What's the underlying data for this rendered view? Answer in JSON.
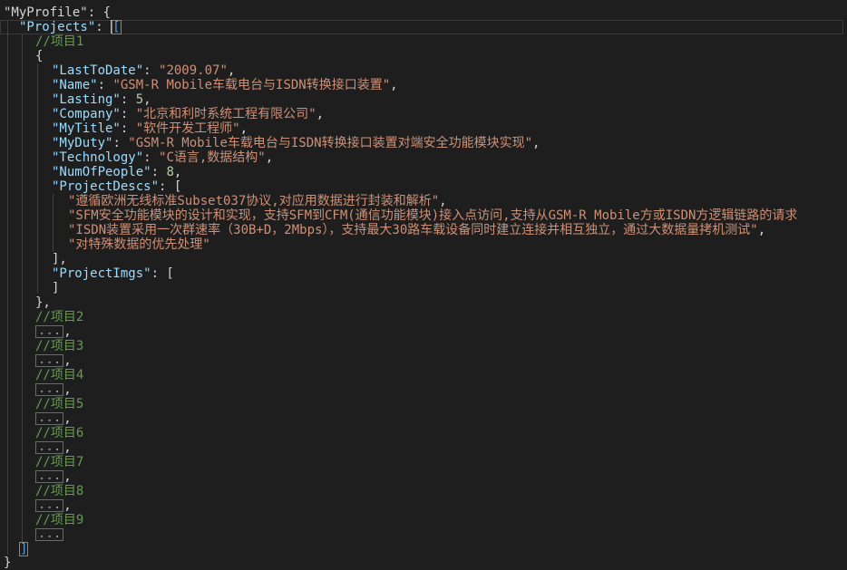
{
  "root_key": "\"MyProfile\"",
  "projects_key": "\"Projects\"",
  "comment_project1": "//项目1",
  "fields": {
    "last_to_date": {
      "key": "\"LastToDate\"",
      "value": "\"2009.07\""
    },
    "name": {
      "key": "\"Name\"",
      "value": "\"GSM-R Mobile车载电台与ISDN转换接口装置\""
    },
    "lasting": {
      "key": "\"Lasting\"",
      "value": "5"
    },
    "company": {
      "key": "\"Company\"",
      "value": "\"北京和利时系统工程有限公司\""
    },
    "my_title": {
      "key": "\"MyTitle\"",
      "value": "\"软件开发工程师\""
    },
    "my_duty": {
      "key": "\"MyDuty\"",
      "value": "\"GSM-R Mobile车载电台与ISDN转换接口装置对端安全功能模块实现\""
    },
    "technology": {
      "key": "\"Technology\"",
      "value": "\"C语言,数据结构\""
    },
    "num_of_people": {
      "key": "\"NumOfPeople\"",
      "value": "8"
    },
    "project_descs": {
      "key": "\"ProjectDescs\""
    },
    "project_imgs": {
      "key": "\"ProjectImgs\""
    }
  },
  "descs": [
    "\"遵循欧洲无线标准Subset037协议,对应用数据进行封装和解析\"",
    "\"SFM安全功能模块的设计和实现，支持SFM到CFM(通信功能模块)接入点访问,支持从GSM-R Mobile方或ISDN方逻辑链路的请求",
    "\"ISDN装置采用一次群速率（30B+D，2Mbps），支持最大30路车载设备同时建立连接并相互独立，通过大数据量拷机测试\"",
    "\"对特殊数据的优先处理\""
  ],
  "collapsed_projects": [
    "//项目2",
    "//项目3",
    "//项目4",
    "//项目5",
    "//项目6",
    "//项目7",
    "//项目8",
    "//项目9"
  ],
  "fold_label": "...",
  "colors": {
    "background": "#1e1e1e",
    "key": "#9cdcfe",
    "string": "#ce9178",
    "number": "#b5cea8",
    "comment": "#6a9955",
    "bracket_highlight": "#569cd6"
  }
}
